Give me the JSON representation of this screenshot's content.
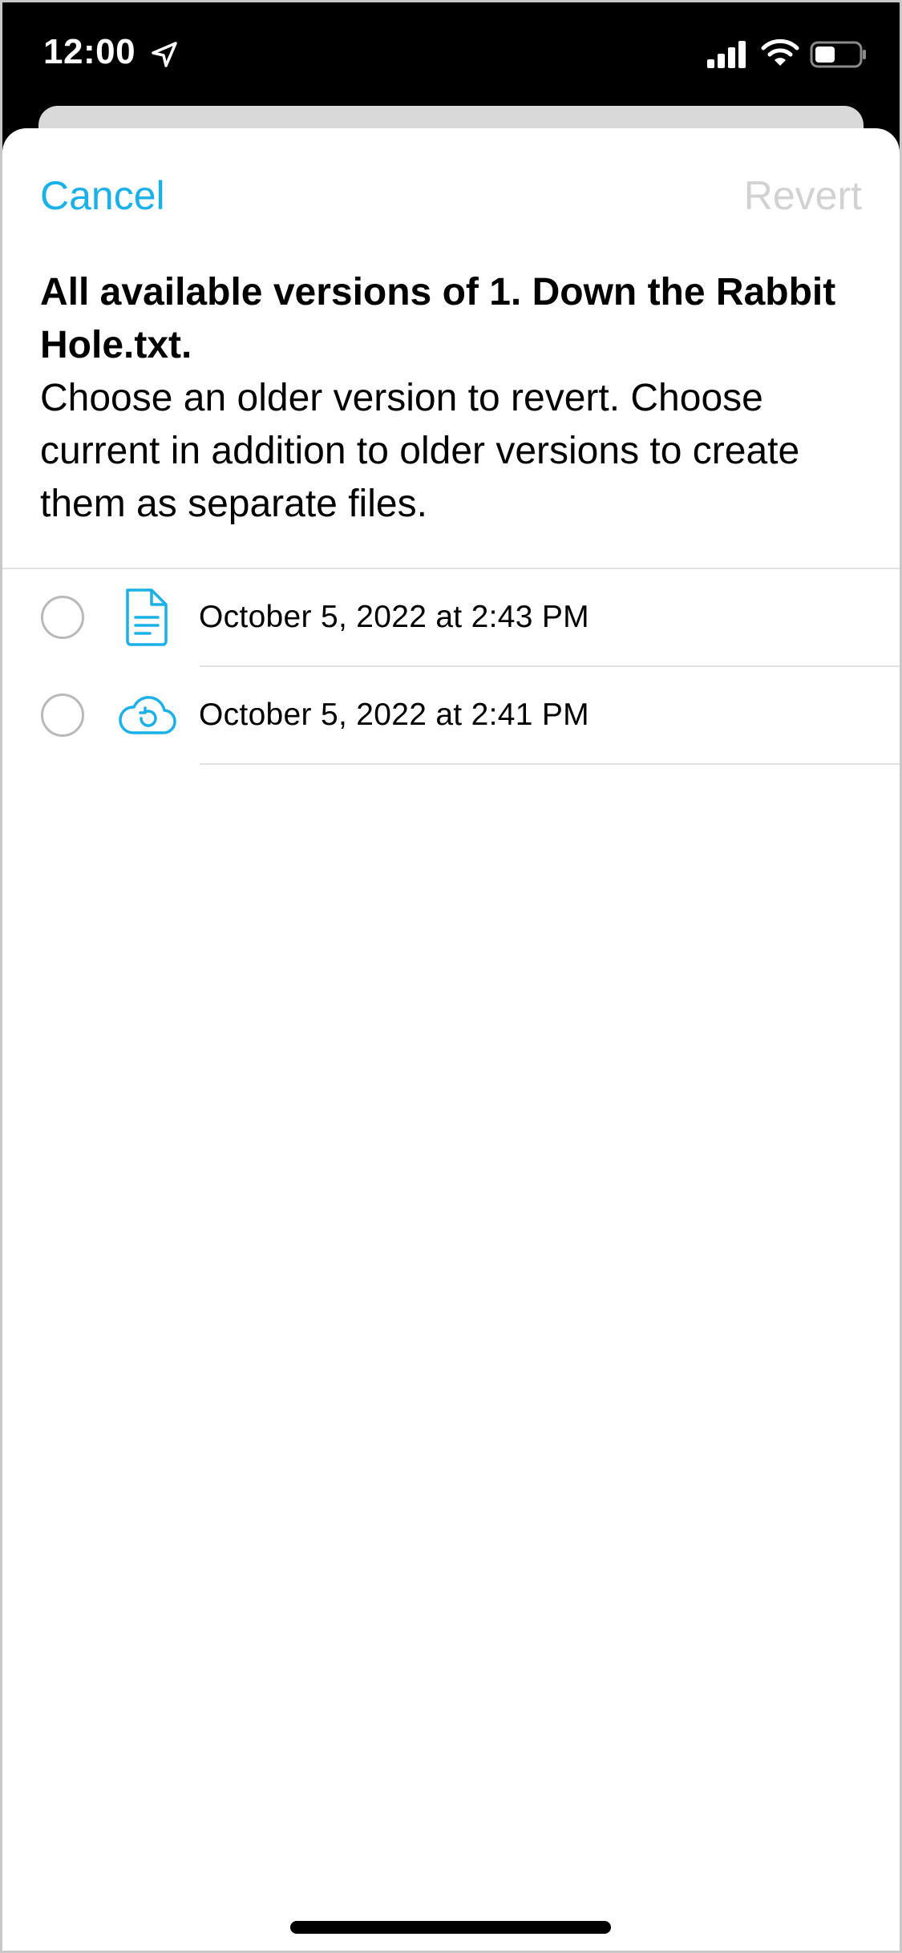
{
  "status_bar": {
    "time": "12:00",
    "icons": [
      "location-arrow-icon",
      "cellular-signal-icon",
      "wifi-icon",
      "battery-icon"
    ]
  },
  "nav": {
    "cancel_label": "Cancel",
    "revert_label": "Revert"
  },
  "header": {
    "title": "All available versions of 1. Down the Rabbit Hole.txt.",
    "description": "Choose an older version to revert. Choose current in addition to older versions to create them as separate files."
  },
  "versions": [
    {
      "label": "October 5, 2022 at 2:43 PM",
      "icon": "document-icon",
      "selected": false
    },
    {
      "label": "October 5, 2022 at 2:41 PM",
      "icon": "cloud-restore-icon",
      "selected": false
    }
  ],
  "colors": {
    "accent": "#1ab0e8",
    "disabled": "#d2d2d2",
    "status_bar_bg": "#000000"
  }
}
